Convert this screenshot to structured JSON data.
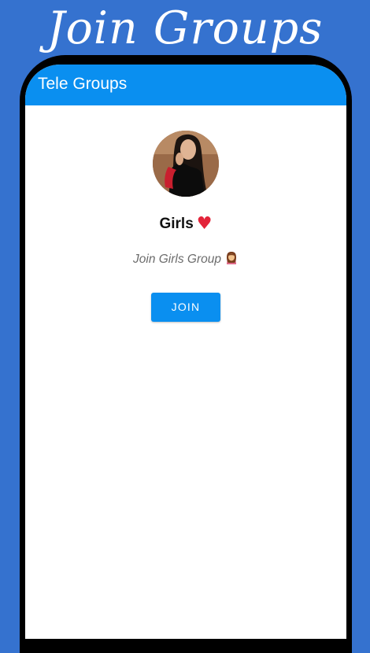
{
  "promo": {
    "title": "Join Groups"
  },
  "app": {
    "title": "Tele Groups"
  },
  "group": {
    "name": "Girls",
    "name_icon": "heart-icon",
    "description": "Join Girls Group",
    "description_icon": "woman-icon",
    "avatar_icon": "profile-photo"
  },
  "actions": {
    "join_label": "JOIN"
  },
  "colors": {
    "background": "#3572cf",
    "app_bar": "#0a8ff0",
    "button": "#0a8ff0",
    "heart": "#e3243a"
  }
}
